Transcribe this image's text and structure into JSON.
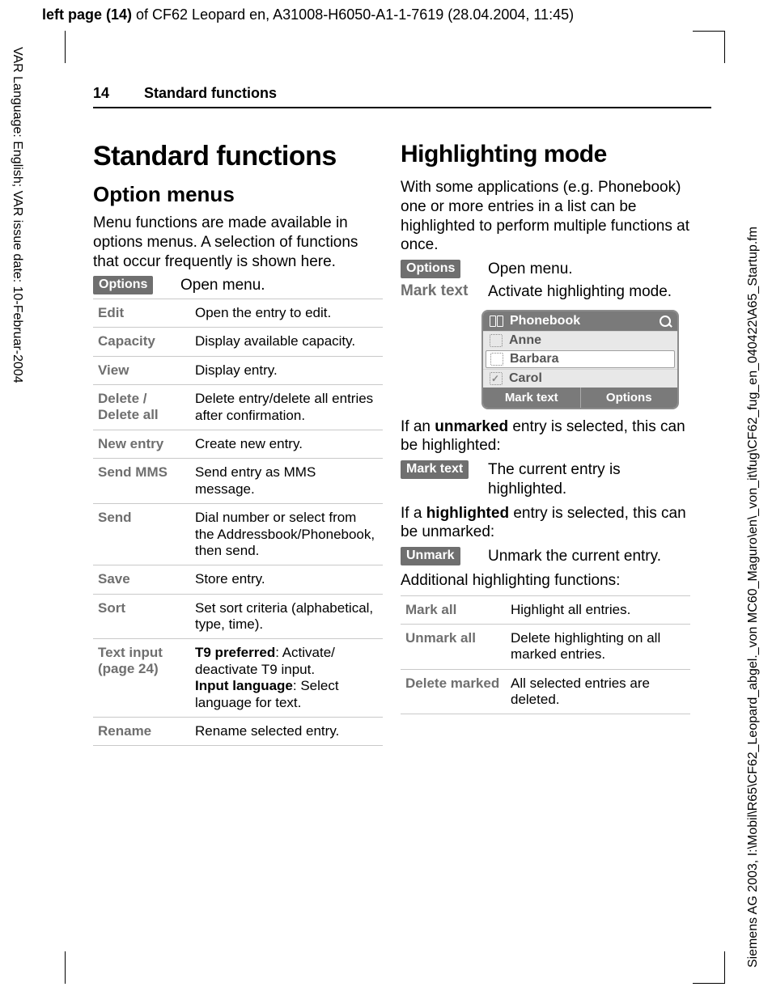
{
  "meta": {
    "top_left": "left page (14)",
    "top_rest": " of CF62 Leopard en, A31008-H6050-A1-1-7619 (28.04.2004, 11:45)",
    "vside_left": "VAR Language: English; VAR issue date: 10-Februar-2004",
    "vside_right": "Siemens AG 2003, I:\\Mobil\\R65\\CF62_Leopard_abgel._von MC60_Maguro\\en\\_von_it\\fug\\CF62_fug_en_040422\\A65_Startup.fm"
  },
  "runhead": {
    "page": "14",
    "section": "Standard functions"
  },
  "left": {
    "h1": "Standard functions",
    "h2": "Option menus",
    "intro": "Menu functions are made available in options menus. A selection of functions that occur frequently is shown here.",
    "options_chip": "Options",
    "options_text": "Open menu.",
    "table": [
      {
        "k": "Edit",
        "v": "Open the entry to edit."
      },
      {
        "k": "Capacity",
        "v": "Display available capacity."
      },
      {
        "k": "View",
        "v": "Display entry."
      },
      {
        "k": "Delete / Delete all",
        "v": "Delete entry/delete all entries after confirmation."
      },
      {
        "k": "New entry",
        "v": "Create new entry."
      },
      {
        "k": "Send MMS",
        "v": "Send entry as MMS message."
      },
      {
        "k": "Send",
        "v": "Dial number or select from the Addressbook/Phonebook, then send."
      },
      {
        "k": "Save",
        "v": "Store entry."
      },
      {
        "k": "Sort",
        "v": "Set sort criteria (alphabetical, type, time)."
      },
      {
        "k": "Text input (page 24)",
        "v_pre1b": "T9 preferred",
        "v_post1": ": Activate/ deactivate T9 input.",
        "v_pre2b": "Input language",
        "v_post2": ": Select language for text."
      },
      {
        "k": "Rename",
        "v": "Rename selected entry."
      }
    ]
  },
  "right": {
    "h1": "Highlighting mode",
    "intro": "With some applications (e.g. Phonebook) one or more entries in a list can be highlighted to perform multiple functions at once.",
    "options_chip": "Options",
    "options_text": "Open menu.",
    "marktext_label": "Mark text",
    "marktext_text": "Activate highlighting mode.",
    "phone": {
      "title": "Phonebook",
      "rows": [
        "Anne",
        "Barbara",
        "Carol"
      ],
      "soft_left": "Mark text",
      "soft_right": "Options"
    },
    "unmarked_p1a": "If an ",
    "unmarked_b": "unmarked",
    "unmarked_p1b": " entry is selected, this can be highlighted:",
    "marktext2_chip": "Mark text",
    "marktext2_text": "The current entry is highlighted.",
    "highlighted_p1a": "If a ",
    "highlighted_b": "highlighted",
    "highlighted_p1b": " entry is selected, this can be unmarked:",
    "unmark_chip": "Unmark",
    "unmark_text": "Unmark the current entry.",
    "additional": "Additional highlighting functions:",
    "table": [
      {
        "k": "Mark all",
        "v": "Highlight all entries."
      },
      {
        "k": "Unmark all",
        "v": "Delete highlighting on all marked entries."
      },
      {
        "k": "Delete marked",
        "v": "All selected entries are deleted."
      }
    ]
  }
}
